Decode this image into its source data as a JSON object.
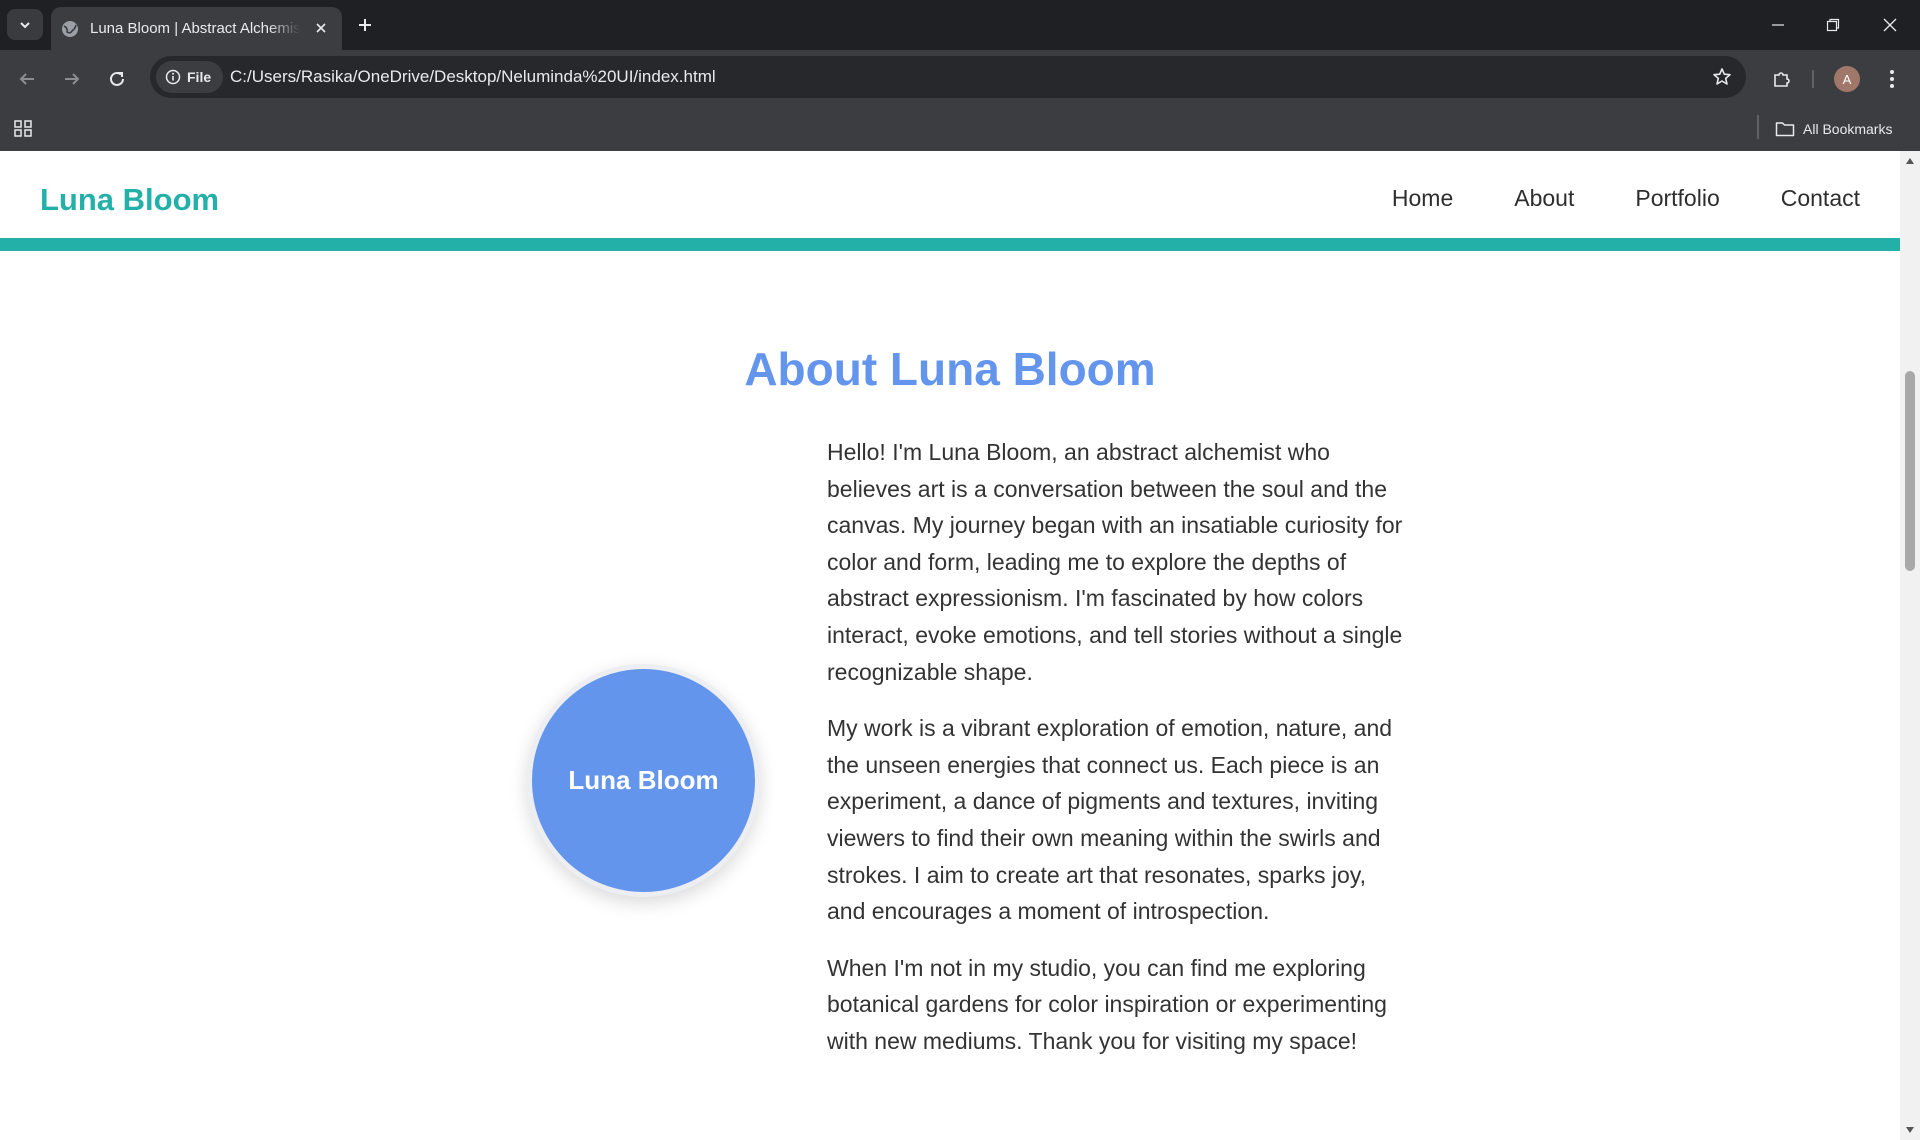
{
  "browser": {
    "tab_title": "Luna Bloom | Abstract Alchemist",
    "address": {
      "chip_label": "File",
      "url": "C:/Users/Rasika/OneDrive/Desktop/Neluminda%20UI/index.html"
    },
    "profile_initial": "A",
    "bookmarks_label": "All Bookmarks"
  },
  "site": {
    "brand": "Luna Bloom",
    "nav": [
      "Home",
      "About",
      "Portfolio",
      "Contact"
    ]
  },
  "about": {
    "title": "About Luna Bloom",
    "portrait_label": "Luna Bloom",
    "paragraphs": [
      "Hello! I'm Luna Bloom, an abstract alchemist who believes art is a conversation between the soul and the canvas. My journey began with an insatiable curiosity for color and form, leading me to explore the depths of abstract expressionism. I'm fascinated by how colors interact, evoke emotions, and tell stories without a single recognizable shape.",
      "My work is a vibrant exploration of emotion, nature, and the unseen energies that connect us. Each piece is an experiment, a dance of pigments and textures, inviting viewers to find their own meaning within the swirls and strokes. I aim to create art that resonates, sparks joy, and encourages a moment of introspection.",
      "When I'm not in my studio, you can find me exploring botanical gardens for color inspiration or experimenting with new mediums. Thank you for visiting my space!"
    ]
  },
  "colors": {
    "brand_teal": "#23b0a8",
    "accent_blue": "#6495ed"
  }
}
